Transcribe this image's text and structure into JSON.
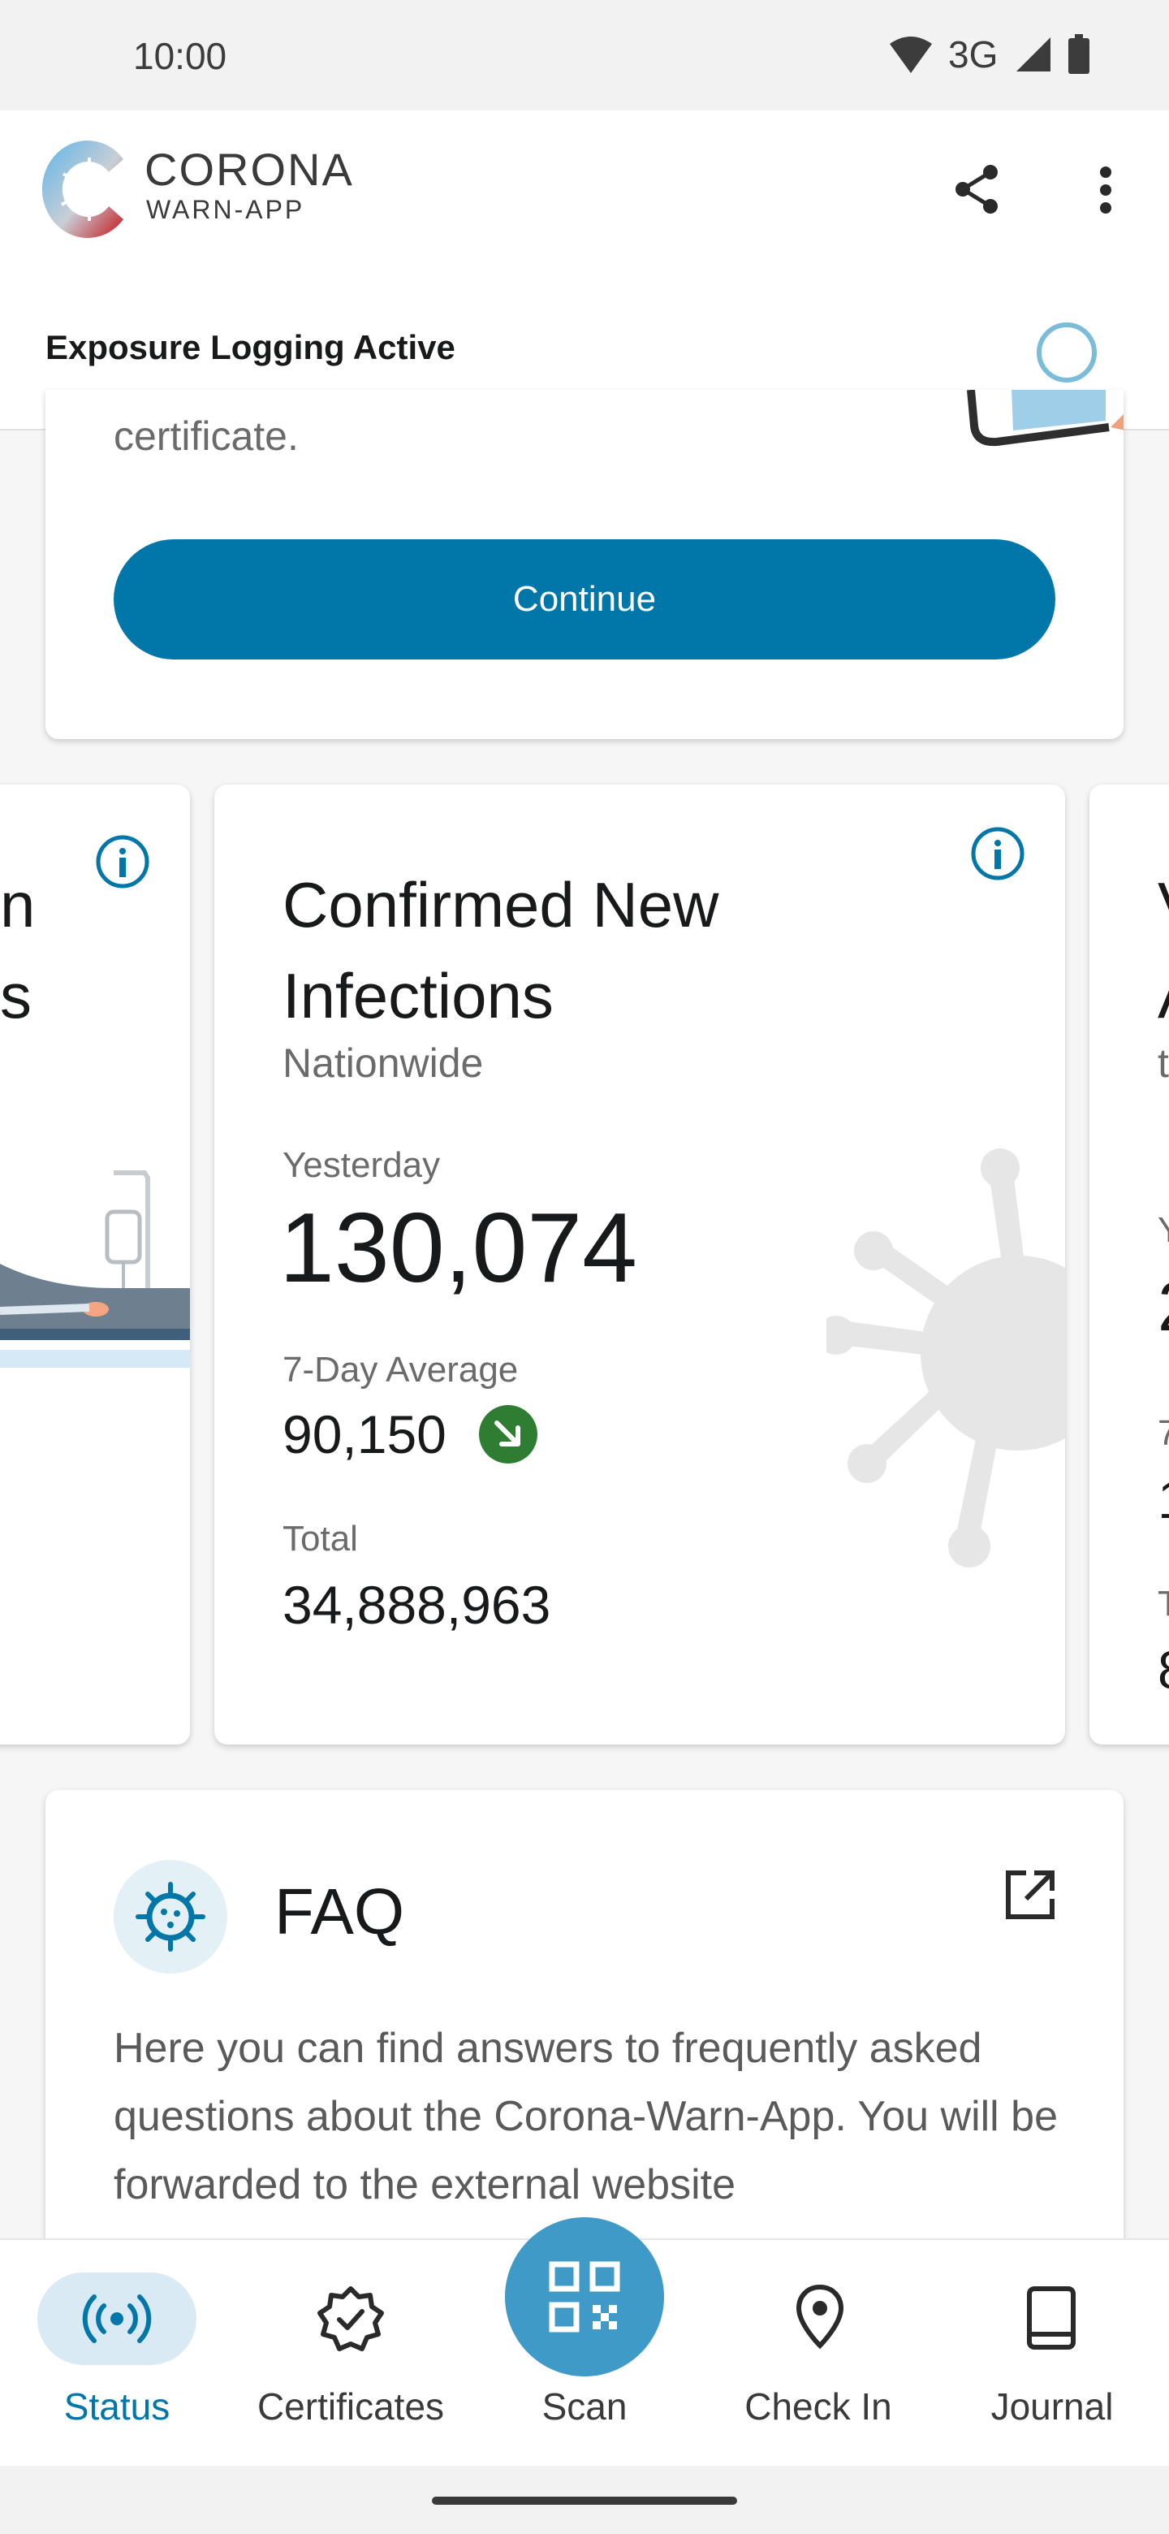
{
  "status_bar": {
    "time": "10:00",
    "network": "3G"
  },
  "header": {
    "logo_line1": "CORONA",
    "logo_line2": "WARN-APP",
    "exposure_status": "Exposure Logging Active"
  },
  "top_card": {
    "partial_text": "certificate.",
    "button_label": "Continue"
  },
  "stats_card": {
    "title": "Confirmed New Infections",
    "subtitle": "Nationwide",
    "yesterday_label": "Yesterday",
    "yesterday_value": "130,074",
    "average_label": "7-Day Average",
    "average_value": "90,150",
    "total_label": "Total",
    "total_value": "34,888,963",
    "trend_color": "#2e7d32"
  },
  "left_partial_card": {
    "line1": "n",
    "line2": "s"
  },
  "right_partial_card": {
    "line1": "V",
    "line2": "A",
    "line3": "t",
    "line4": "Y",
    "line5": "2",
    "line6": "7",
    "line7": "1",
    "line8": "T",
    "line9": "8"
  },
  "faq": {
    "title": "FAQ",
    "text": "Here you can find answers to frequently asked questions about the Corona-Warn-App. You will be forwarded to the external website"
  },
  "bottom_nav": {
    "status": "Status",
    "certificates": "Certificates",
    "scan": "Scan",
    "check_in": "Check In",
    "journal": "Journal"
  },
  "colors": {
    "accent": "#0077a8",
    "nav_active_bg": "#d9eaf4",
    "scan_fab": "#3f9ac7",
    "faq_icon_bg": "#e3f0f6"
  }
}
